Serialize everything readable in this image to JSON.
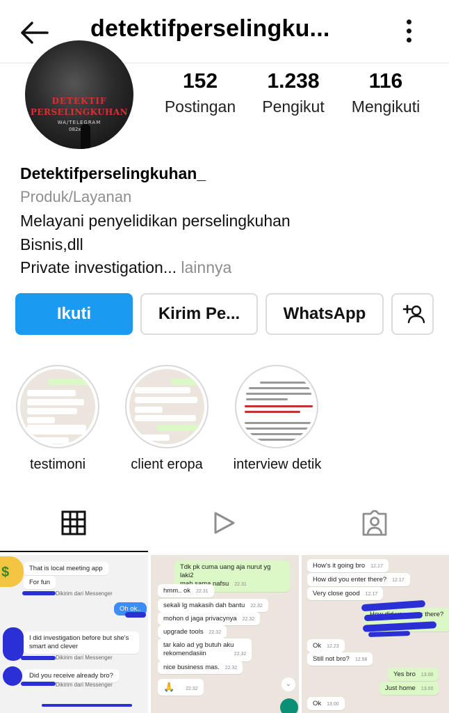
{
  "header": {
    "title": "detektifperselingku..."
  },
  "profile": {
    "avatar_text": [
      "DETEKTIF",
      "PERSELINGKUHAN",
      "WA/TELEGRAM",
      "082xxxx"
    ],
    "stats": [
      {
        "num": "152",
        "label": "Postingan"
      },
      {
        "num": "1.238",
        "label": "Pengikut"
      },
      {
        "num": "116",
        "label": "Mengikuti"
      }
    ],
    "name": "Detektifperselingkuhan_",
    "category": "Produk/Layanan",
    "bio": [
      "Melayani penyelidikan perselingkuhan",
      "Bisnis,dll",
      "Private investigation..."
    ],
    "more": " lainnya"
  },
  "buttons": {
    "follow": "Ikuti",
    "message": "Kirim Pe...",
    "whatsapp": "WhatsApp"
  },
  "highlights": [
    {
      "label": "testimoni"
    },
    {
      "label": "client eropa"
    },
    {
      "label": "interview detik"
    }
  ],
  "posts": {
    "p1": {
      "b1": "That is local meeting app",
      "b2": "For fun",
      "sent1": "Dikirim dari Messenger",
      "g1": "Oh ok..",
      "b3": "I did investigation before but she's smart and clever",
      "sent2": "Dikirim dari Messenger",
      "b4": "Did you receive already bro?",
      "sent3": "Dikirim dari Messenger"
    },
    "p2": {
      "g1": "Tdk pk cuma uang aja nurut yg laki2",
      "g1b": "mah sama nafsu",
      "g1t": "22.31",
      "b1": "hmm.. ok",
      "b1t": "22.31",
      "b2": "sekali lg makasih dah bantu",
      "b2t": "22.32",
      "b3": "mohon d jaga privacynya",
      "b3t": "22.32",
      "b4": "upgrade tools",
      "b4t": "22.32",
      "b5": "tar kalo ad yg butuh aku",
      "b5b": "rekomendasiin",
      "b5t": "22.32",
      "b6": "nice business mas.",
      "b6t": "22.32",
      "b7": "🙏",
      "b7t": "22.32"
    },
    "p3": {
      "b1": "How's it going bro",
      "b1t": "12.17",
      "b2": "How did you enter there?",
      "b2t": "12.17",
      "b3": "Very close good",
      "b3t": "12.17",
      "g1": "How did you enter there?",
      "b4": "Ok",
      "b4t": "12.23",
      "b5": "Still not bro?",
      "b5t": "12.58",
      "g2": "Yes bro",
      "g2t": "13.00",
      "g3": "Just home",
      "g3t": "13.00",
      "b6": "Ok",
      "b6t": "13.00"
    }
  }
}
